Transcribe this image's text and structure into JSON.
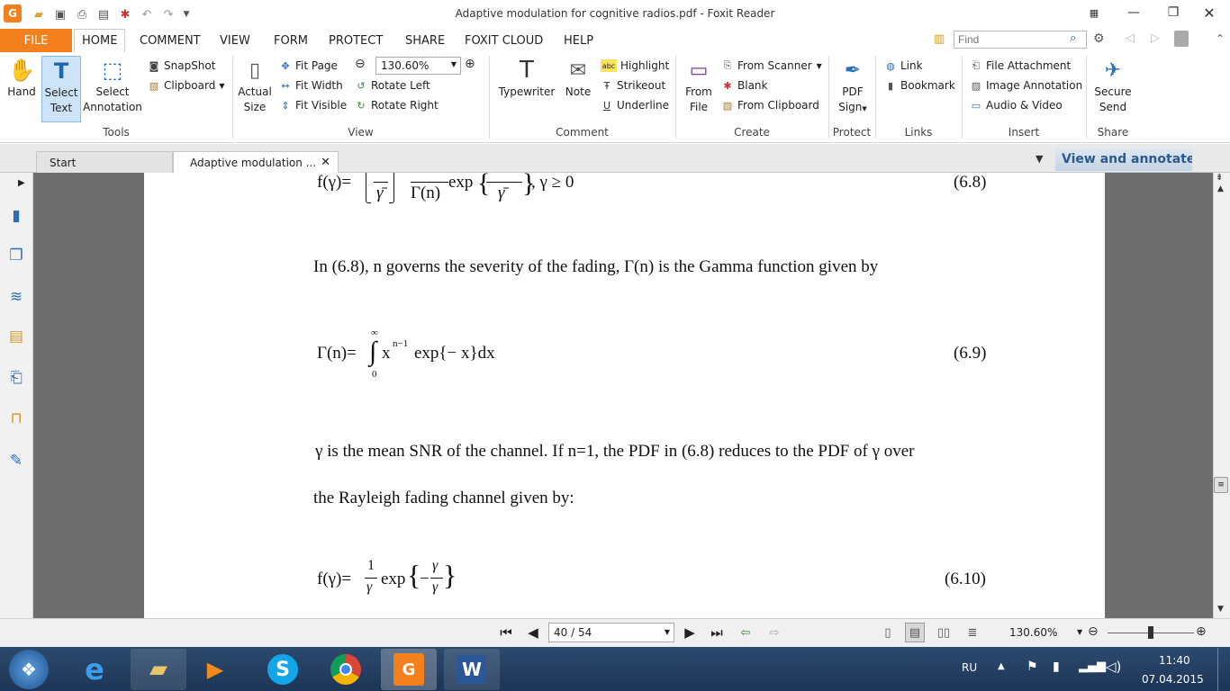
{
  "window": {
    "title": "Adaptive modulation for cognitive radios.pdf - Foxit Reader"
  },
  "menu": {
    "file": "FILE",
    "tabs": [
      "HOME",
      "COMMENT",
      "VIEW",
      "FORM",
      "PROTECT",
      "SHARE",
      "FOXIT CLOUD",
      "HELP"
    ]
  },
  "search": {
    "placeholder": "Find"
  },
  "ribbon": {
    "tools": {
      "label": "Tools",
      "hand": "Hand",
      "select_text_1": "Select",
      "select_text_2": "Text",
      "select_annot_1": "Select",
      "select_annot_2": "Annotation",
      "snapshot": "SnapShot",
      "clipboard": "Clipboard"
    },
    "view": {
      "label": "View",
      "actual_1": "Actual",
      "actual_2": "Size",
      "fit_page": "Fit Page",
      "fit_width": "Fit Width",
      "fit_visible": "Fit Visible",
      "zoom": "130.60%",
      "rotate_left": "Rotate Left",
      "rotate_right": "Rotate Right"
    },
    "comment": {
      "label": "Comment",
      "typewriter": "Typewriter",
      "note": "Note",
      "highlight": "Highlight",
      "strikeout": "Strikeout",
      "underline": "Underline"
    },
    "create": {
      "label": "Create",
      "from_file_1": "From",
      "from_file_2": "File",
      "from_scanner": "From Scanner",
      "blank": "Blank",
      "from_clipboard": "From Clipboard"
    },
    "protect": {
      "label": "Protect",
      "pdf_sign_1": "PDF",
      "pdf_sign_2": "Sign"
    },
    "links": {
      "label": "Links",
      "link": "Link",
      "bookmark": "Bookmark"
    },
    "insert": {
      "label": "Insert",
      "file_attachment": "File Attachment",
      "image_annotation": "Image Annotation",
      "audio_video": "Audio & Video"
    },
    "share": {
      "label": "Share",
      "secure_1": "Secure",
      "secure_2": "Send"
    }
  },
  "tabs": {
    "start": "Start",
    "doc": "Adaptive modulation ...",
    "banner": "View and annotate P"
  },
  "doc": {
    "eq1_lhs": "f(γ)=",
    "eq1_mid": "exp",
    "eq1_tail": ", γ ≥ 0",
    "eq1_num": "(6.8)",
    "para1": "In (6.8), n governs the severity of the fading,  Γ(n)  is the Gamma function given by",
    "eq2_lhs": "Γ(n)=",
    "eq2_int_top": "∞",
    "eq2_int_bot": "0",
    "eq2_x": "x",
    "eq2_exp": "n−1",
    "eq2_rest": "exp{− x}dx",
    "eq2_num": "(6.9)",
    "para2": "γ  is the mean SNR of the channel. If n=1, the PDF in (6.8) reduces to the PDF of  γ  over",
    "para3": "the Rayleigh fading channel given by:",
    "eq3_lhs": "f(γ)=",
    "eq3_num_1": "1",
    "eq3_den_1": "γ",
    "eq3_mid": "exp",
    "eq3_minus": "−",
    "eq3_num_2": "γ",
    "eq3_den_2": "γ",
    "eq3_num": "(6.10)"
  },
  "status": {
    "page": "40 / 54",
    "zoom": "130.60%"
  },
  "taskbar": {
    "lang": "RU",
    "time": "11:40",
    "date": "07.04.2015"
  }
}
